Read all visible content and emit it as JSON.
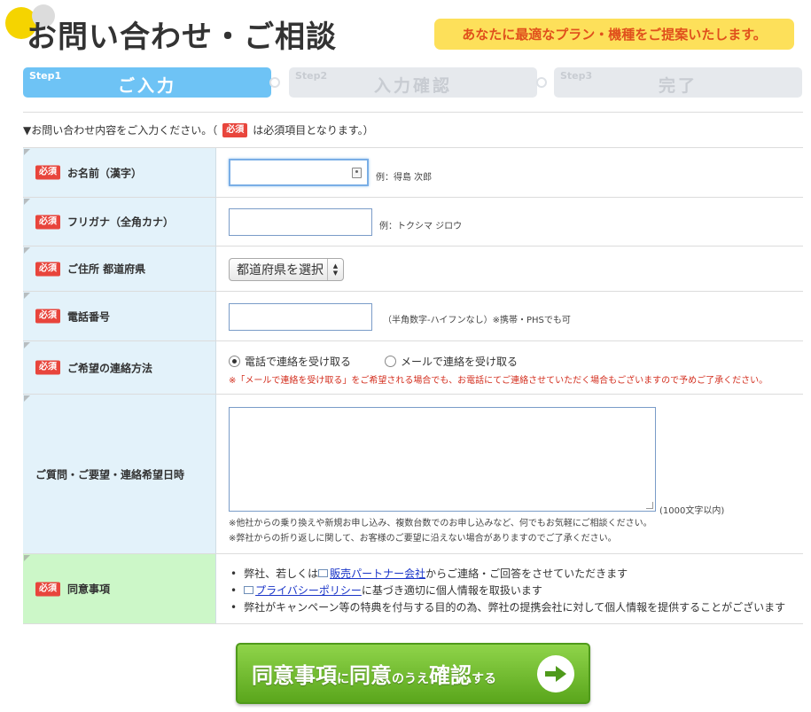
{
  "header": {
    "title": "お問い合わせ・ご相談",
    "badge": "あなたに最適なプラン・機種をご提案いたします。"
  },
  "steps": [
    {
      "num": "Step1",
      "label": "ご入力",
      "active": true
    },
    {
      "num": "Step2",
      "label": "入力確認",
      "active": false
    },
    {
      "num": "Step3",
      "label": "完了",
      "active": false
    }
  ],
  "intro": {
    "prefix": "▼お問い合わせ内容をご入力ください。（",
    "suffix": "は必須項目となります。）"
  },
  "required_label": "必須",
  "fields": {
    "name": {
      "label": "お名前（漢字）",
      "value": "",
      "hint": "例：得島 次郎"
    },
    "kana": {
      "label": "フリガナ（全角カナ）",
      "value": "",
      "hint": "例：トクシマ ジロウ"
    },
    "prefecture": {
      "label": "ご住所 都道府県",
      "selected": "都道府県を選択"
    },
    "phone": {
      "label": "電話番号",
      "value": "",
      "hint": "（半角数字-ハイフンなし）※携帯・PHSでも可"
    },
    "contact_method": {
      "label": "ご希望の連絡方法",
      "options": [
        "電話で連絡を受け取る",
        "メールで連絡を受け取る"
      ],
      "selected_index": 0,
      "note": "※「メールで連絡を受け取る」をご希望される場合でも、お電話にてご連絡させていただく場合もございますので予めご了承ください。"
    },
    "inquiry": {
      "label": "ご質問・ご要望・連絡希望日時",
      "value": "",
      "limit": "(1000文字以内)",
      "note1": "※他社からの乗り換えや新規お申し込み、複数台数でのお申し込みなど、何でもお気軽にご相談ください。",
      "note2": "※弊社からの折り返しに関して、お客様のご要望に沿えない場合がありますのでご了承ください。"
    },
    "agreement": {
      "label": "同意事項",
      "item1_before": "弊社、若しくは",
      "item1_link": "販売パートナー会社",
      "item1_after": "からご連絡・ご回答をさせていただきます",
      "item2_link": "プライバシーポリシー",
      "item2_after": "に基づき適切に個人情報を取扱います",
      "item3": "弊社がキャンペーン等の特典を付与する目的の為、弊社の提携会社に対して個人情報を提供することがございます"
    }
  },
  "submit": {
    "part1": "同意事項",
    "part2": "に",
    "part3": "同意",
    "part4": "のうえ",
    "part5": "確認",
    "part6": "する"
  },
  "colors": {
    "accent_blue": "#6ec3f5",
    "required_red": "#e8453c",
    "submit_green": "#5aa61c",
    "badge_yellow": "#fde05a"
  }
}
